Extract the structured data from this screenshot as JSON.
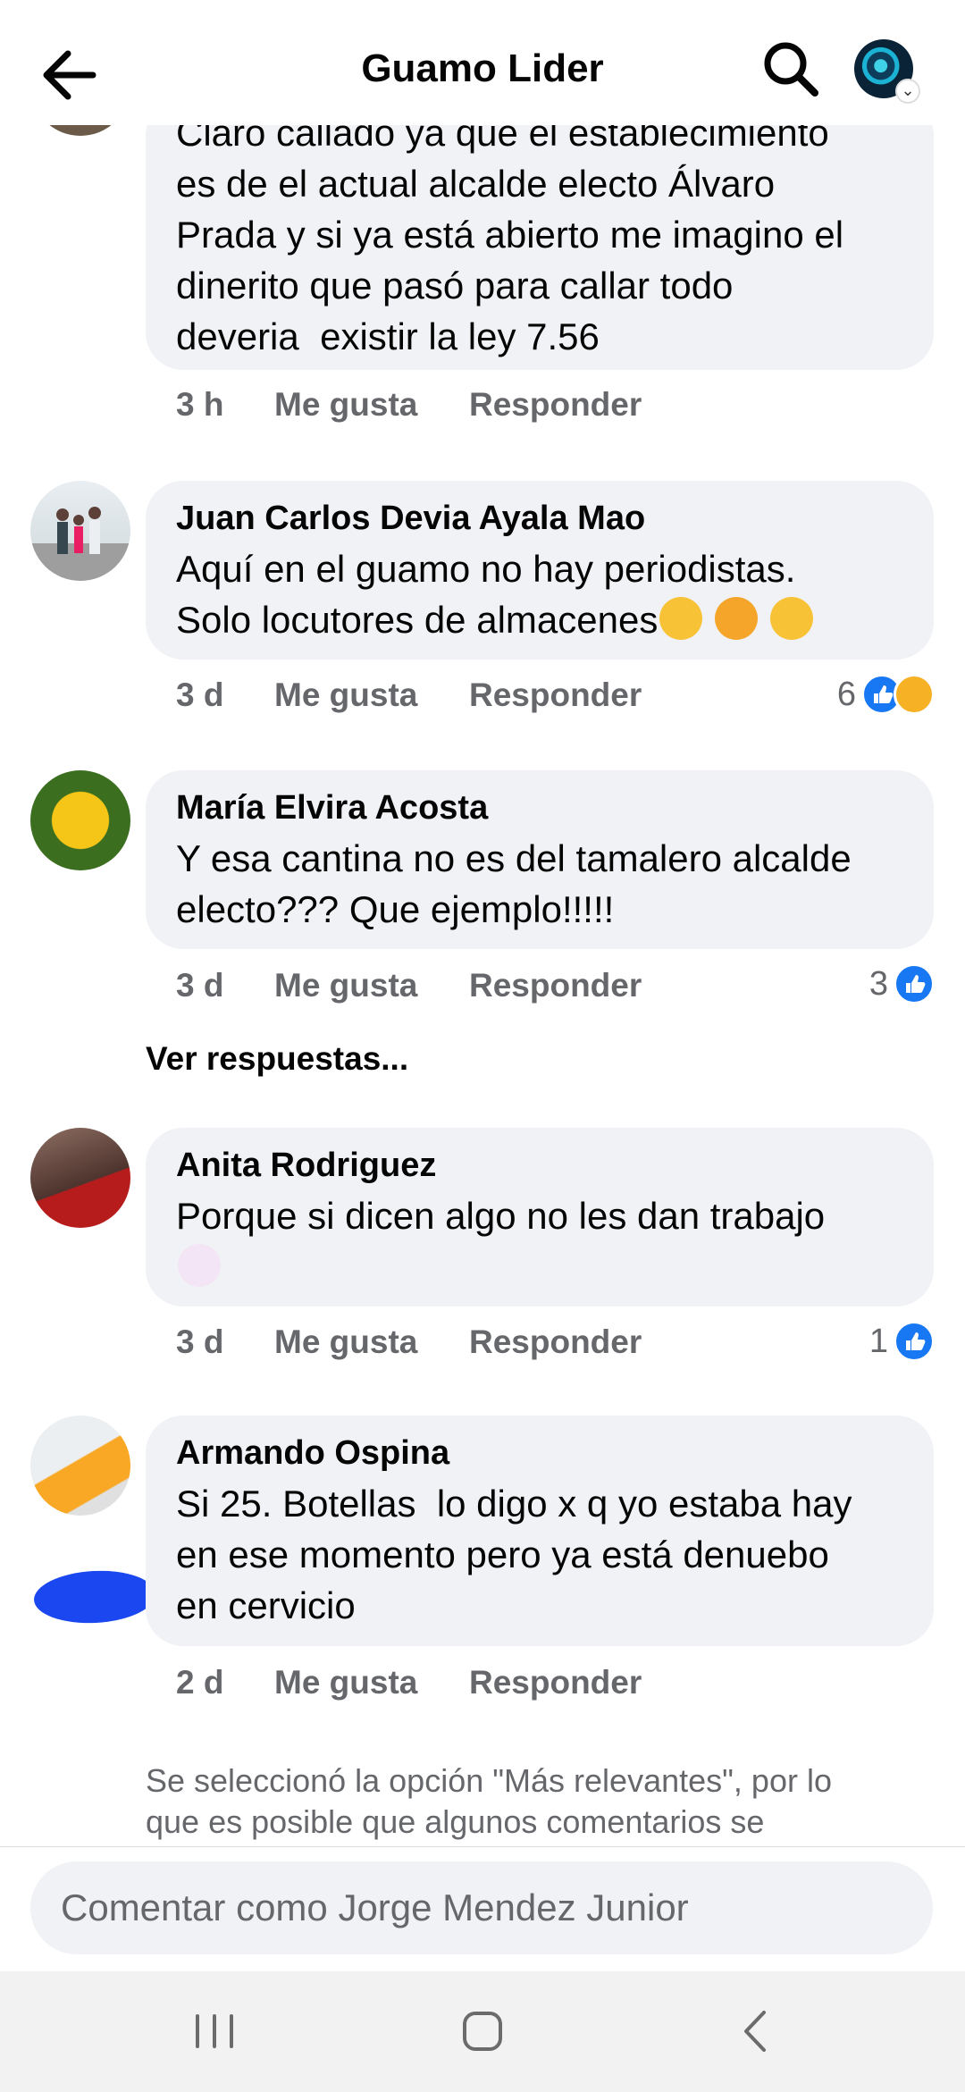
{
  "header": {
    "title": "Guamo Lider",
    "back_icon": "back-arrow-icon",
    "search_icon": "search-icon",
    "profile_icon": "profile-avatar-icon"
  },
  "comments": [
    {
      "name": "",
      "text": "Claro callado ya que el establecimiento\nes de el actual alcalde electo Álvaro\nPrada y si ya está abierto me imagino el\ndinerito que pasó para callar todo\ndeveria  existir la ley 7.56",
      "time": "3 h",
      "like_label": "Me gusta",
      "reply_label": "Responder",
      "reaction_count": null
    },
    {
      "name": "Juan Carlos Devia Ayala Mao",
      "text": "Aquí en el guamo no hay periodistas.\nSolo locutores de almacenes",
      "emojis": [
        "thinking-face-emoji",
        "tears-of-joy-emoji",
        "zipper-mouth-emoji"
      ],
      "time": "3 d",
      "like_label": "Me gusta",
      "reply_label": "Responder",
      "reaction_count": "6",
      "reactions": [
        "like-icon",
        "haha-icon"
      ]
    },
    {
      "name": "María Elvira Acosta",
      "text": "Y esa cantina no es del tamalero alcalde\nelecto??? Que ejemplo!!!!!",
      "time": "3 d",
      "like_label": "Me gusta",
      "reply_label": "Responder",
      "reaction_count": "3",
      "reactions": [
        "like-icon"
      ]
    },
    {
      "name": "Anita Rodriguez",
      "text": "Porque si dicen algo no les dan trabajo",
      "emojis": [
        "shrugging-woman-emoji"
      ],
      "time": "3 d",
      "like_label": "Me gusta",
      "reply_label": "Responder",
      "reaction_count": "1",
      "reactions": [
        "like-icon"
      ]
    },
    {
      "name": "Armando Ospina",
      "text": "Si 25. Botellas  lo digo x q yo estaba hay\nen ese momento pero ya está denuebo\nen cervicio",
      "time": "2 d",
      "like_label": "Me gusta",
      "reply_label": "Responder",
      "reaction_count": null
    }
  ],
  "see_replies": "Ver respuestas...",
  "footer_note": "Se seleccionó la opción \"Más relevantes\", por lo que es posible que algunos comentarios se",
  "comment_input": {
    "placeholder": "Comentar como Jorge Mendez Junior"
  },
  "colors": {
    "bubble_bg": "#f0f2f5",
    "secondary_text": "#65676b",
    "like_blue": "#1877f2",
    "redaction_blob": "#1a47f0"
  },
  "navbar": {
    "icons": [
      "recent-apps-icon",
      "home-icon",
      "system-back-icon"
    ]
  }
}
